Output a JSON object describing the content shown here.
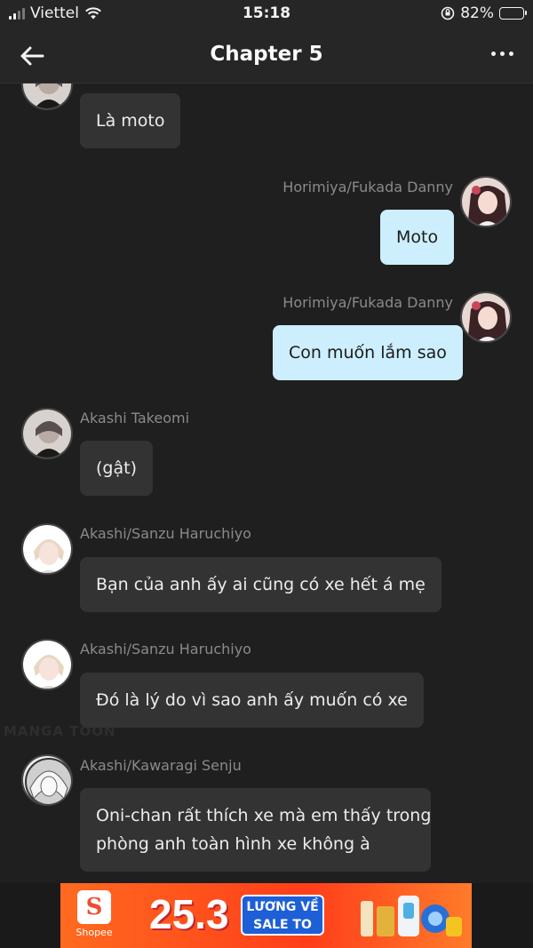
{
  "status_bar": {
    "carrier": "Viettel",
    "time": "15:18",
    "battery": "82%",
    "battery_level": 0.82
  },
  "header": {
    "title": "Chapter 5",
    "back_icon": "arrow-left-icon",
    "menu_icon": "more-horizontal-icon"
  },
  "messages": [
    {
      "side": "in",
      "author": "",
      "text": "Là moto"
    },
    {
      "side": "out",
      "author": "Horimiya/Fukada Danny",
      "text": "Moto"
    },
    {
      "side": "out",
      "author": "Horimiya/Fukada Danny",
      "text": "Con muốn lắm sao"
    },
    {
      "side": "in",
      "author": "Akashi Takeomi",
      "text": "(gật)"
    },
    {
      "side": "in",
      "author": "Akashi/Sanzu Haruchiyo",
      "text": "Bạn của anh ấy ai cũng có xe hết á mẹ"
    },
    {
      "side": "in",
      "author": "Akashi/Sanzu Haruchiyo",
      "text": "Đó là lý do vì sao anh ấy muốn có xe"
    },
    {
      "side": "in",
      "author": "Akashi/Kawaragi Senju",
      "text_line1": "Oni-chan rất thích xe mà em thấy trong",
      "text_line2": "phòng anh toàn hình xe không à"
    }
  ],
  "watermark": "MANGA TOON",
  "ad": {
    "brand": "Shopee",
    "logo_letter": "S",
    "date": "25.3",
    "promo_line1": "LƯƠNG VỀ",
    "promo_line2": "SALE TO",
    "colors": {
      "background": "#ff4e1e",
      "promo": "#1d5fd6"
    }
  },
  "colors": {
    "background": "#1f1f1f",
    "incoming_bubble": "#333333",
    "outgoing_bubble": "#cdeefd",
    "author": "#8a8a8a"
  }
}
